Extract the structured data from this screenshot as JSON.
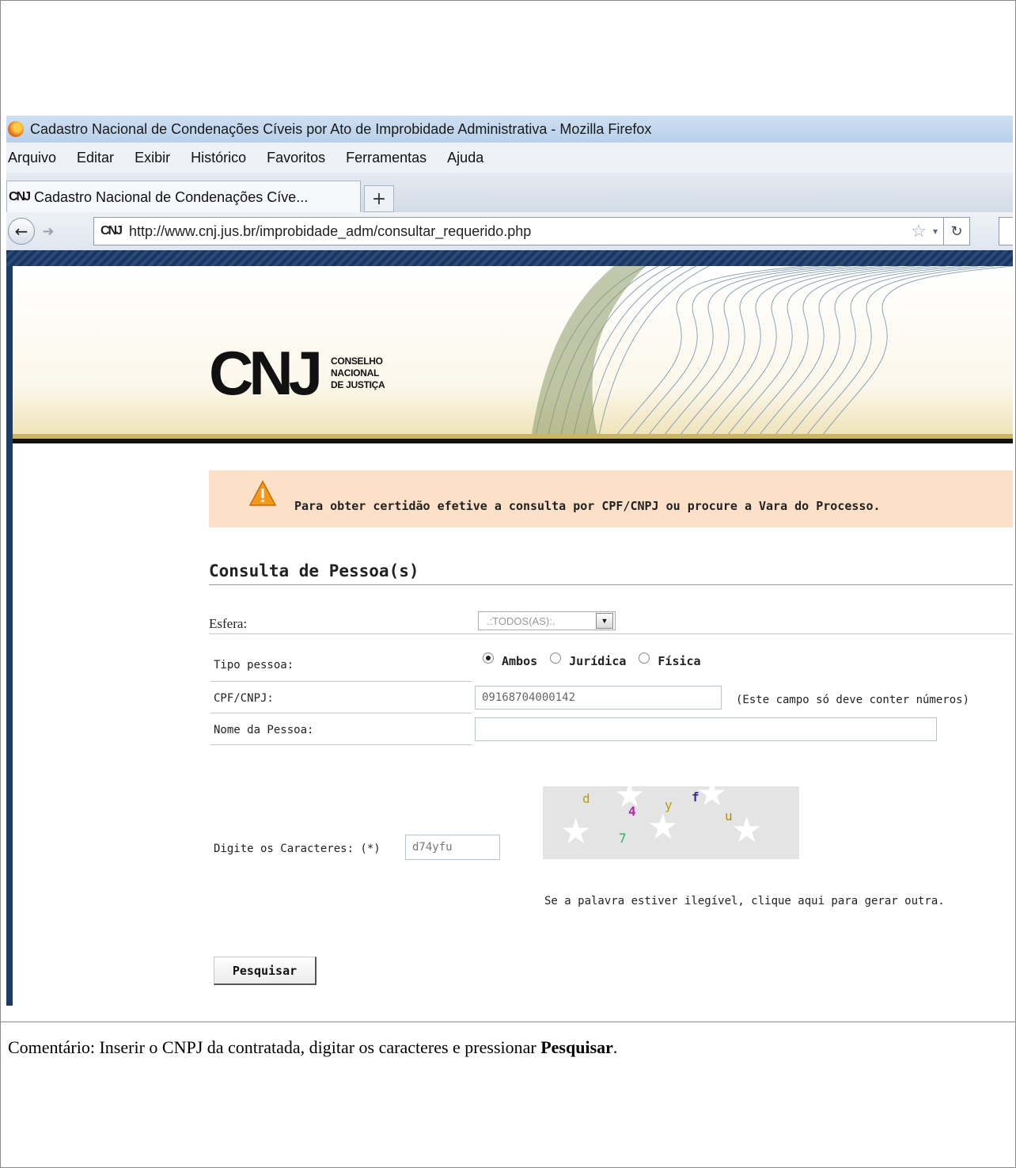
{
  "window": {
    "title": "Cadastro Nacional de Condenações Cíveis por Ato de Improbidade Administrativa - Mozilla Firefox"
  },
  "menu": {
    "items": [
      "Arquivo",
      "Editar",
      "Exibir",
      "Histórico",
      "Favoritos",
      "Ferramentas",
      "Ajuda"
    ]
  },
  "tabs": {
    "active_label": "Cadastro Nacional de Condenações Cíve...",
    "favicon": "CNJ",
    "new_tab_label": "+"
  },
  "navbar": {
    "url": "http://www.cnj.jus.br/improbidade_adm/consultar_requerido.php",
    "favicon": "CNJ"
  },
  "header": {
    "logo_text": "CNJ",
    "logo_sub_lines": [
      "CONSELHO",
      "NACIONAL",
      "DE JUSTIÇA"
    ]
  },
  "alert": {
    "message": "Para obter certidão efetive a consulta por CPF/CNPJ ou procure a Vara do Processo.",
    "icon": "warning-icon",
    "color": "#fde0c8"
  },
  "form": {
    "section_title": "Consulta de Pessoa(s)",
    "esfera": {
      "label": "Esfera:",
      "selected": ".:TODOS(AS):."
    },
    "tipo_pessoa": {
      "label": "Tipo pessoa:",
      "options": [
        "Ambos",
        "Jurídica",
        "Física"
      ],
      "selected": "Ambos"
    },
    "cpf_cnpj": {
      "label": "CPF/CNPJ:",
      "value": "09168704000142",
      "hint": "(Este campo só deve conter números)"
    },
    "nome": {
      "label": "Nome da Pessoa:",
      "value": ""
    },
    "captcha": {
      "label": "Digite os Caracteres: (*)",
      "value": "d74yfu",
      "chars": [
        "d",
        "4",
        "y",
        "f",
        "u",
        "7"
      ],
      "regen_text": "Se a palavra estiver ilegível, clique aqui para gerar outra."
    },
    "submit_label": "Pesquisar"
  },
  "comment": {
    "prefix": "Comentário: Inserir o CNPJ da contratada, digitar os caracteres e pressionar ",
    "bold": "Pesquisar",
    "suffix": "."
  }
}
